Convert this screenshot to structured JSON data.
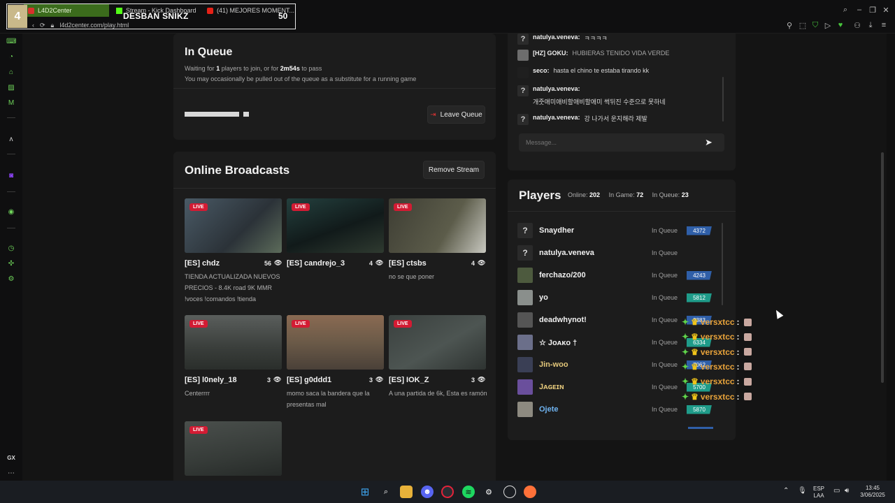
{
  "browser": {
    "tabs": [
      {
        "label": "L4D2Center"
      },
      {
        "label": "Stream - Kick Dashboard"
      },
      {
        "label": "(41) MEJORES MOMENT..."
      }
    ],
    "url": "l4d2center.com/play.html",
    "overlay": {
      "rank": "4",
      "name": "DESBAN SNIKZ",
      "score": "50"
    }
  },
  "queue": {
    "title": "In Queue",
    "line1_prefix": "Waiting for",
    "line1_count": "1",
    "line1_mid": "players to join, or for",
    "line1_time": "2m54s",
    "line1_suffix": "to pass",
    "line2": "You may occasionally be pulled out of the queue as a substitute for a running game",
    "leave_label": "Leave Queue"
  },
  "broadcasts": {
    "title": "Online Broadcasts",
    "remove_label": "Remove Stream",
    "live_badge": "LIVE",
    "cards": [
      {
        "title": "[ES] chdz",
        "views": "56",
        "desc": "TIENDA ACTUALIZADA NUEVOS PRECIOS - 8.4K road 9K MMR !voces !comandos !tienda",
        "thumb": "#3a4a52"
      },
      {
        "title": "[ES] candrejo_3",
        "views": "4",
        "desc": "",
        "thumb": "#1f3634"
      },
      {
        "title": "[ES] ctsbs",
        "views": "4",
        "desc": "no se que poner",
        "thumb": "#4a4a3c"
      },
      {
        "title": "[ES] l0nely_18",
        "views": "3",
        "desc": "Centerrrr",
        "thumb": "#474b49"
      },
      {
        "title": "[ES] g0ddd1",
        "views": "3",
        "desc": "momo saca la bandera que la presentas mal",
        "thumb": "#6b5a48"
      },
      {
        "title": "[ES] IOK_Z",
        "views": "3",
        "desc": "A una partida de 6k, Esta es ramón",
        "thumb": "#3f4544"
      },
      {
        "title": "",
        "views": "",
        "desc": "",
        "thumb": "#3d413f"
      }
    ]
  },
  "chat": {
    "messages": [
      {
        "avatar": "?",
        "user": "natulya.veneva:",
        "text": "ㅋㅋㅋㅋ"
      },
      {
        "avatar": "",
        "user": "[HZ] GOKU:",
        "text": "HUBIERAS TENIDO VIDA VERDE"
      },
      {
        "avatar": "",
        "user": "seco:",
        "text": "hasta el chino te estaba tirando kk"
      },
      {
        "avatar": "?",
        "user": "natulya.veneva:",
        "text": "개줏애미애비할애비할애미 썩뒤진 수준으로 못하네"
      },
      {
        "avatar": "?",
        "user": "natulya.veneva:",
        "text": "강 나가서 운지해라 제발"
      }
    ],
    "placeholder": "Message..."
  },
  "players": {
    "title": "Players",
    "online_label": "Online:",
    "online": "202",
    "ingame_label": "In Game:",
    "ingame": "72",
    "inqueue_label": "In Queue:",
    "inqueue": "23",
    "rows": [
      {
        "name": "Snaydher",
        "status": "In Queue",
        "elo": "4372",
        "elo_color": "#2f5fa8",
        "avatar": "?",
        "av_color": "#2a2a2a",
        "name_color": "#f0f0f0"
      },
      {
        "name": "natulya.veneva",
        "status": "In Queue",
        "elo": "",
        "elo_color": "",
        "avatar": "?",
        "av_color": "#2a2a2a",
        "name_color": "#f0f0f0"
      },
      {
        "name": "ferchazo/200",
        "status": "In Queue",
        "elo": "4243",
        "elo_color": "#2f5fa8",
        "avatar": "",
        "av_color": "#4d5a3e",
        "name_color": "#f0f0f0"
      },
      {
        "name": "yo",
        "status": "In Queue",
        "elo": "5812",
        "elo_color": "#1f9c8a",
        "avatar": "",
        "av_color": "#8a8f8c",
        "name_color": "#f0f0f0"
      },
      {
        "name": "deadwhynot!",
        "status": "In Queue",
        "elo": "3383",
        "elo_color": "#2f5fa8",
        "avatar": "",
        "av_color": "#555",
        "name_color": "#f0f0f0"
      },
      {
        "name": "☆ Jᴏᴀᴋᴏ †",
        "status": "In Queue",
        "elo": "6334",
        "elo_color": "#1f9c8a",
        "avatar": "",
        "av_color": "#6b6f8a",
        "name_color": "#f0f0f0"
      },
      {
        "name": "Jin-woo",
        "status": "In Queue",
        "elo": "7062",
        "elo_color": "#2f5fa8",
        "avatar": "",
        "av_color": "#3a3f55",
        "name_color": "#e3c77a"
      },
      {
        "name": "Jᴀɢᴇɪɴ",
        "status": "In Queue",
        "elo": "5700",
        "elo_color": "#1f9c8a",
        "avatar": "",
        "av_color": "#6a4f9c",
        "name_color": "#e3c77a"
      },
      {
        "name": "Ojete",
        "status": "In Queue",
        "elo": "5870",
        "elo_color": "#1f9c8a",
        "avatar": "",
        "av_color": "#8d8a80",
        "name_color": "#6fb3f0"
      }
    ]
  },
  "versxtcc": {
    "label": "versxtcc",
    "suffix": ":",
    "count": 6
  },
  "taskbar": {
    "lang1": "ESP",
    "lang2": "LAA",
    "time": "13:45",
    "date": "3/06/2025"
  }
}
